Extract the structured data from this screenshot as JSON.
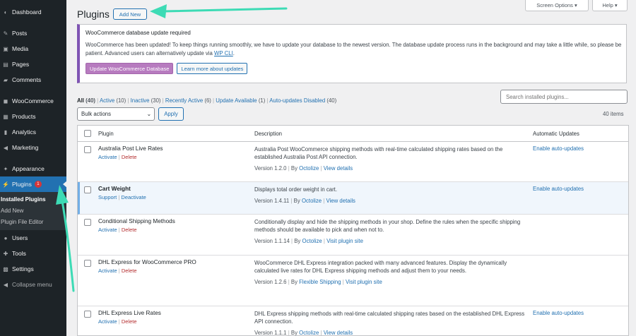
{
  "sidebar": {
    "items": [
      {
        "label": "Dashboard",
        "icon": "dashboard-icon",
        "glyph": "◐"
      },
      {
        "label": "Posts",
        "icon": "pin-icon",
        "glyph": "✎"
      },
      {
        "label": "Media",
        "icon": "media-icon",
        "glyph": "▣"
      },
      {
        "label": "Pages",
        "icon": "pages-icon",
        "glyph": "▤"
      },
      {
        "label": "Comments",
        "icon": "comments-icon",
        "glyph": "▰"
      },
      {
        "label": "WooCommerce",
        "icon": "woocommerce-icon",
        "glyph": "◼"
      },
      {
        "label": "Products",
        "icon": "products-icon",
        "glyph": "▦"
      },
      {
        "label": "Analytics",
        "icon": "analytics-icon",
        "glyph": "▮"
      },
      {
        "label": "Marketing",
        "icon": "marketing-icon",
        "glyph": "◀"
      },
      {
        "label": "Appearance",
        "icon": "appearance-icon",
        "glyph": "✦"
      },
      {
        "label": "Plugins",
        "icon": "plugins-icon",
        "glyph": "⚡",
        "badge": "1"
      },
      {
        "label": "Users",
        "icon": "users-icon",
        "glyph": "●"
      },
      {
        "label": "Tools",
        "icon": "tools-icon",
        "glyph": "✚"
      },
      {
        "label": "Settings",
        "icon": "settings-icon",
        "glyph": "▩"
      },
      {
        "label": "Collapse menu",
        "icon": "collapse-icon",
        "glyph": "◀"
      }
    ],
    "submenu": [
      "Installed Plugins",
      "Add New",
      "Plugin File Editor"
    ]
  },
  "header": {
    "title": "Plugins",
    "add_new": "Add New",
    "screen_options": "Screen Options ▾",
    "help": "Help ▾"
  },
  "notice": {
    "title": "WooCommerce database update required",
    "text_before_link": "WooCommerce has been updated! To keep things running smoothly, we have to update your database to the newest version. The database update process runs in the background and may take a little while, so please be patient. Advanced users can alternatively update via ",
    "link": "WP CLI",
    "text_after_link": ".",
    "primary_button": "Update WooCommerce Database",
    "secondary_button": "Learn more about updates",
    "accent_color": "#7f54b3"
  },
  "filters": [
    {
      "label": "All",
      "count": "(40)"
    },
    {
      "label": "Active",
      "count": "(10)"
    },
    {
      "label": "Inactive",
      "count": "(30)"
    },
    {
      "label": "Recently Active",
      "count": "(6)"
    },
    {
      "label": "Update Available",
      "count": "(1)"
    },
    {
      "label": "Auto-updates Disabled",
      "count": "(40)"
    }
  ],
  "search": {
    "placeholder": "Search installed plugins..."
  },
  "bulk": {
    "selected": "Bulk actions",
    "apply": "Apply",
    "items_count": "40 items"
  },
  "table": {
    "columns": {
      "plugin": "Plugin",
      "description": "Description",
      "auto": "Automatic Updates"
    },
    "rows": [
      {
        "name": "Australia Post Live Rates",
        "actions": [
          "Activate",
          "Delete"
        ],
        "description": "Australia Post WooCommerce shipping methods with real-time calculated shipping rates based on the established Australia Post API connection.",
        "version": "Version 1.2.0",
        "by_label": "By",
        "author": "Octolize",
        "detail": "View details",
        "auto": "Enable auto-updates",
        "active": false
      },
      {
        "name": "Cart Weight",
        "actions": [
          "Support",
          "Deactivate"
        ],
        "description": "Displays total order weight in cart.",
        "version": "Version 1.4.11",
        "by_label": "By",
        "author": "Octolize",
        "detail": "View details",
        "auto": "Enable auto-updates",
        "active": true
      },
      {
        "name": "Conditional Shipping Methods",
        "actions": [
          "Activate",
          "Delete"
        ],
        "description": "Conditionally display and hide the shipping methods in your shop. Define the rules when the specific shipping methods should be available to pick and when not to.",
        "version": "Version 1.1.14",
        "by_label": "By",
        "author": "Octolize",
        "detail": "Visit plugin site",
        "auto": "",
        "active": false
      },
      {
        "name": "DHL Express for WooCommerce PRO",
        "actions": [
          "Activate",
          "Delete"
        ],
        "description": "WooCommerce DHL Express integration packed with many advanced features. Display the dynamically calculated live rates for DHL Express shipping methods and adjust them to your needs.",
        "version": "Version 1.2.6",
        "by_label": "By",
        "author": "Flexible Shipping",
        "detail": "Visit plugin site",
        "auto": "",
        "active": false
      },
      {
        "name": "DHL Express Live Rates",
        "actions": [
          "Activate",
          "Delete"
        ],
        "description": "DHL Express shipping methods with real-time calculated shipping rates based on the established DHL Express API connection.",
        "version": "Version 1.1.1",
        "by_label": "By",
        "author": "Octolize",
        "detail": "View details",
        "auto": "Enable auto-updates",
        "active": false
      }
    ]
  },
  "annotation": {
    "arrow_color": "#3ddbb5"
  }
}
